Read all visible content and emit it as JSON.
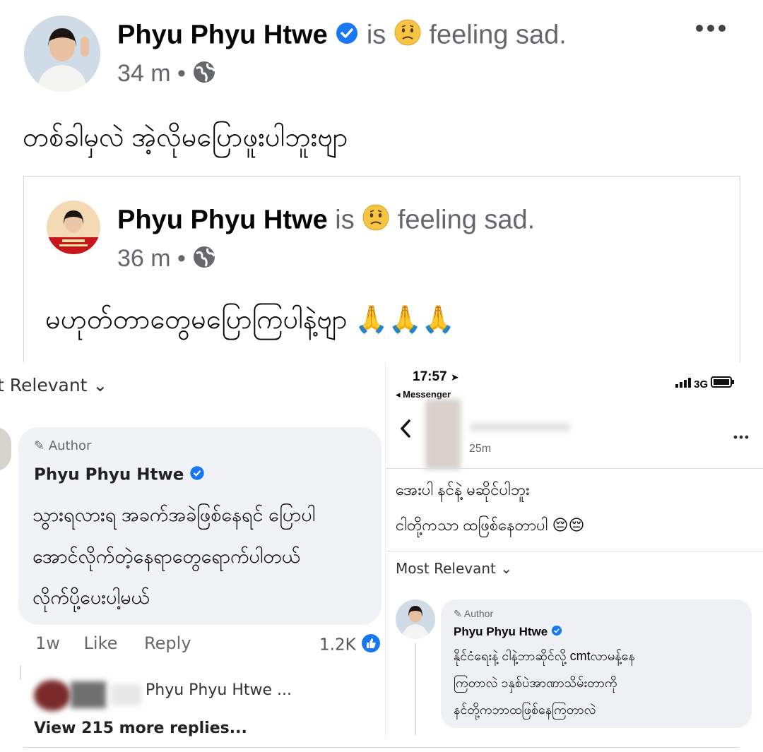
{
  "post": {
    "author": "Phyu Phyu Htwe",
    "is_word": "is",
    "feeling": "feeling sad.",
    "time": "34 m",
    "dot": "•",
    "body": "တစ်ခါမှလဲ အဲ့လိုမပြောဖူးပါဘူးဗျာ",
    "more_icon": "ellipsis-icon"
  },
  "shared_post": {
    "author": "Phyu Phyu Htwe",
    "is_word": "is",
    "feeling": "feeling sad.",
    "time": "36 m",
    "dot": "•",
    "body": "မဟုတ်တာတွေမပြောကြပါနဲ့ဗျာ 🙏🙏🙏"
  },
  "left_screenshot": {
    "sort_label": "t Relevant",
    "author_badge": "Author",
    "commenter": "Phyu Phyu Htwe",
    "comment_lines": [
      "သွားရလားရ အခက်အခဲဖြစ်နေရင် ပြောပါ",
      "အောင်လိုက်တဲ့နေရာတွေရောက်ပါတယ်",
      "လိုက်ပို့ပေးပါ့မယ်"
    ],
    "time": "1w",
    "like": "Like",
    "reply": "Reply",
    "reaction_count": "1.2K",
    "reply_preview": "Phyu Phyu Htwe ...",
    "view_more": "View 215 more replies..."
  },
  "right_screenshot": {
    "status_time": "17:57",
    "back_app": "◂ Messenger",
    "network": "3G",
    "post_time": "25m",
    "post_lines": [
      "အေးပါ နင်နဲ့ မဆိုင်ပါဘူး",
      "ငါတို့ကသာ ထဖြစ်နေတာပါ 😔😔"
    ],
    "sort_label": "Most Relevant",
    "author_badge": "Author",
    "commenter": "Phyu Phyu Htwe",
    "comment_lines": [
      "နိုင်ငံရေးနဲ့ ငါနဲ့ဘာဆိုင်လို့ cmtလာမန့်နေ",
      "ကြတာလဲ ၁နှစ်ပဲအာဏာသိမ်းတာကို",
      "နင်တို့ကဘာထဖြစ်နေကြတာလဲ"
    ]
  },
  "colors": {
    "verified_blue": "#1877f2",
    "text_grey": "#65676b",
    "bubble_grey": "#f0f2f5"
  }
}
